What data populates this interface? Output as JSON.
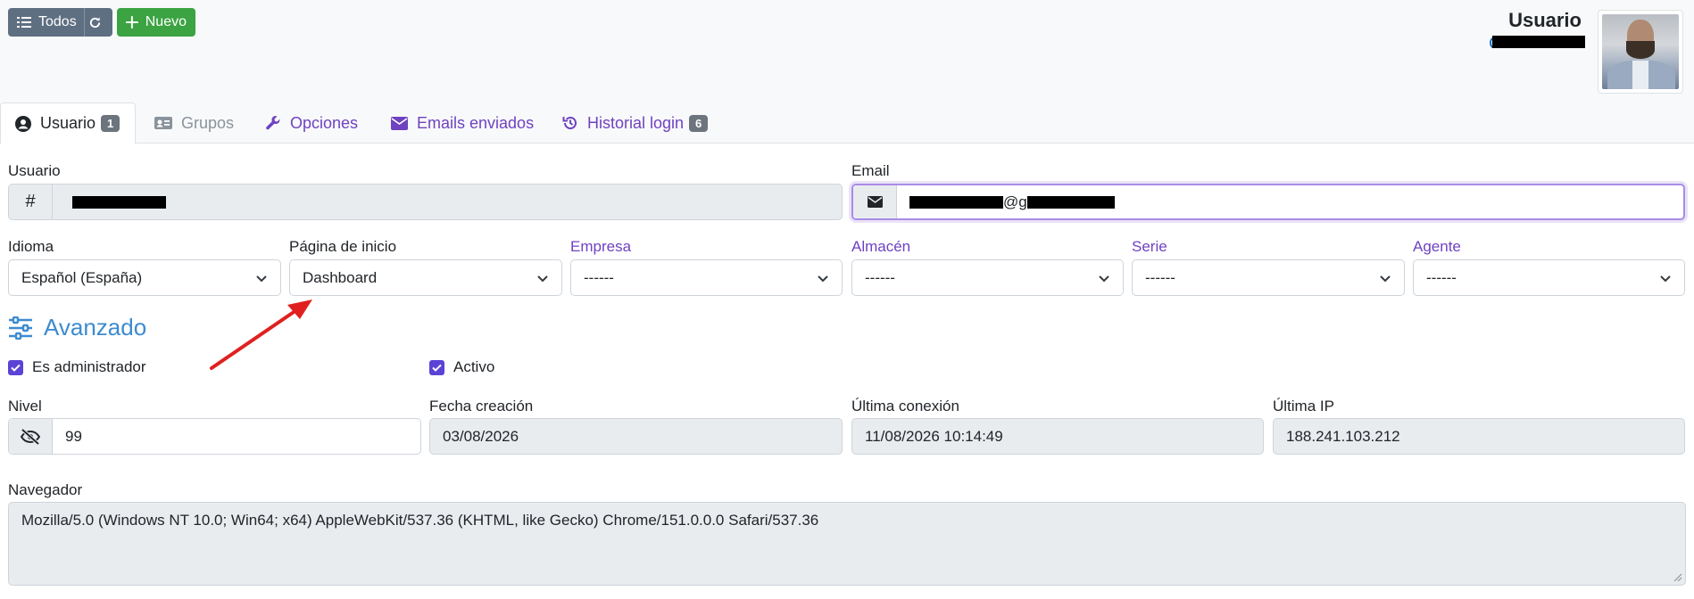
{
  "toolbar": {
    "all_label": "Todos",
    "new_label": "Nuevo"
  },
  "header": {
    "title": "Usuario"
  },
  "tabs": [
    {
      "label": "Usuario",
      "badge": "1"
    },
    {
      "label": "Grupos"
    },
    {
      "label": "Opciones"
    },
    {
      "label": "Emails enviados"
    },
    {
      "label": "Historial login",
      "badge": "6"
    }
  ],
  "form": {
    "usuario_label": "Usuario",
    "usuario_addon": "#",
    "email_label": "Email",
    "email_fragment": "@g",
    "idioma_label": "Idioma",
    "idioma_value": "Español (España)",
    "pagina_label": "Página de inicio",
    "pagina_value": "Dashboard",
    "empresa_label": "Empresa",
    "empresa_value": "------",
    "almacen_label": "Almacén",
    "almacen_value": "------",
    "serie_label": "Serie",
    "serie_value": "------",
    "agente_label": "Agente",
    "agente_value": "------"
  },
  "advanced": {
    "title": "Avanzado",
    "admin_label": "Es administrador",
    "admin_checked": true,
    "active_label": "Activo",
    "active_checked": true,
    "nivel_label": "Nivel",
    "nivel_value": "99",
    "fecha_label": "Fecha creación",
    "fecha_value": "03/08/2026",
    "conexion_label": "Última conexión",
    "conexion_value": "11/08/2026 10:14:49",
    "ip_label": "Última IP",
    "ip_value": "188.241.103.212",
    "navegador_label": "Navegador",
    "navegador_value": "Mozilla/5.0 (Windows NT 10.0; Win64; x64) AppleWebKit/537.36 (KHTML, like Gecko) Chrome/151.0.0.0 Safari/537.36"
  },
  "colors": {
    "accent": "#6f42c1",
    "success": "#3ba342",
    "secondary": "#5f6f82",
    "section": "#3d8bd0",
    "annotation": "#e02020"
  }
}
